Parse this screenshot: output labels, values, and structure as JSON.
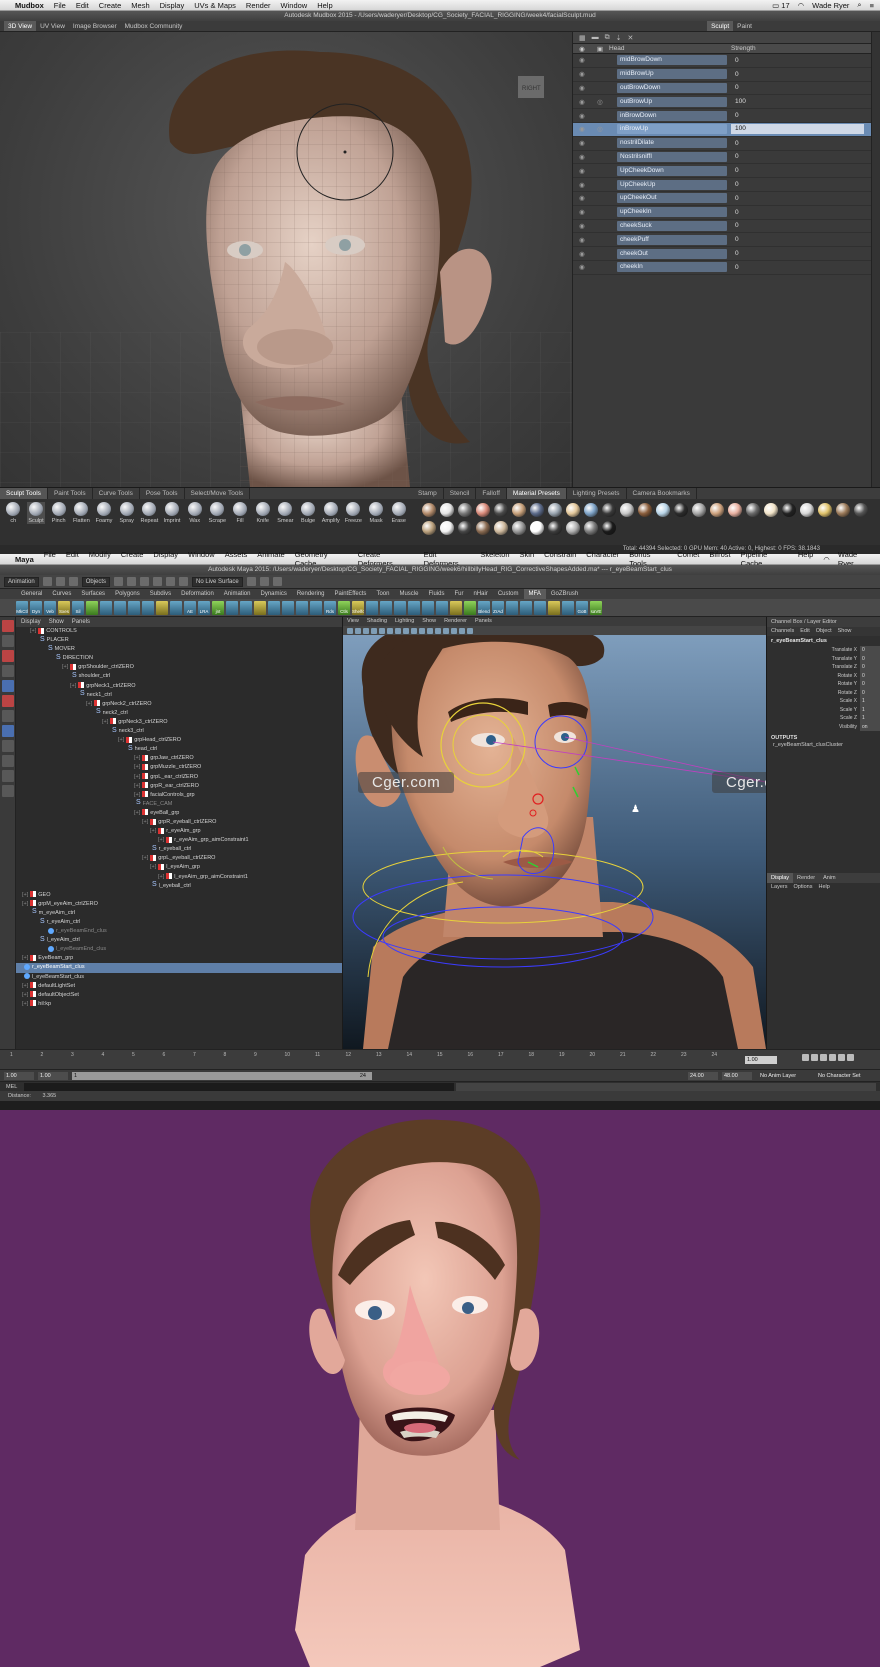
{
  "mudbox": {
    "menubar": {
      "app": "Mudbox",
      "items": [
        "File",
        "Edit",
        "Create",
        "Mesh",
        "Display",
        "UVs & Maps",
        "Render",
        "Window",
        "Help"
      ],
      "user": "Wade Ryer",
      "battery": "17"
    },
    "window_title": "Autodesk Mudbox 2015 - /Users/waderyer/Desktop/CG_Society_FACIAL_RIGGING/week4/facialSculpt.mud",
    "view_tabs": [
      "3D View",
      "UV View",
      "Image Browser",
      "Mudbox Community"
    ],
    "mode_tabs": [
      "Sculpt",
      "Paint"
    ],
    "layer_header": {
      "name": "Head",
      "strength": "Strength"
    },
    "layers": [
      {
        "name": "midBrowDown",
        "strength": "0"
      },
      {
        "name": "midBrowUp",
        "strength": "0"
      },
      {
        "name": "outBrowDown",
        "strength": "0"
      },
      {
        "name": "outBrowUp",
        "strength": "100"
      },
      {
        "name": "inBrowDown",
        "strength": "0"
      },
      {
        "name": "inBrowUp",
        "strength": "100",
        "selected": true
      },
      {
        "name": "nostrilDilate",
        "strength": "0"
      },
      {
        "name": "NostrilsniffI",
        "strength": "0"
      },
      {
        "name": "UpCheekDown",
        "strength": "0"
      },
      {
        "name": "UpCheekUp",
        "strength": "0"
      },
      {
        "name": "upCheekOut",
        "strength": "0"
      },
      {
        "name": "upCheekIn",
        "strength": "0"
      },
      {
        "name": "cheekSuck",
        "strength": "0"
      },
      {
        "name": "cheekPuff",
        "strength": "0"
      },
      {
        "name": "cheekOut",
        "strength": "0"
      },
      {
        "name": "cheekIn",
        "strength": "0"
      }
    ],
    "tray_tabs_left": [
      "Sculpt Tools",
      "Paint Tools",
      "Curve Tools",
      "Pose Tools",
      "Select/Move Tools"
    ],
    "tray_tabs_right": [
      "Stamp",
      "Stencil",
      "Falloff",
      "Material Presets",
      "Lighting Presets",
      "Camera Bookmarks"
    ],
    "brushes": [
      "ch",
      "Sculpt",
      "Pinch",
      "Flatten",
      "Foamy",
      "Spray",
      "Repeat",
      "Imprint",
      "Wax",
      "Scrape",
      "Fill",
      "Knife",
      "Smear",
      "Bulge",
      "Amplify",
      "Freeze",
      "Mask",
      "Erase"
    ],
    "material_colors": [
      "#b48c6c",
      "#e6e6e6",
      "#7a7a7a",
      "#d98a7a",
      "#4a4a4a",
      "#c7a07a",
      "#5c6b8a",
      "#9aa5b0",
      "#e4c89b",
      "#7ea3c7",
      "#3a3a3a",
      "#c9c9c9",
      "#8b5e3c",
      "#b9d5e8",
      "#2b2b2b",
      "#a7a7a7",
      "#cfa37f",
      "#e8b0a0",
      "#6b6b6b",
      "#f1e3c8",
      "#222222",
      "#d8d8d8",
      "#e0c26b",
      "#9c7b5a",
      "#555555",
      "#bca27e",
      "#f3f3f3",
      "#474747",
      "#896a51",
      "#cdb89c",
      "#999999",
      "#ffffff",
      "#3d3d3d",
      "#b0b0b0",
      "#7c7c7c",
      "#1a1a1a"
    ],
    "status": "Total: 44394   Selected: 0   GPU Mem: 40   Active: 0, Highest: 0   FPS: 38.1843"
  },
  "maya": {
    "menubar": {
      "app": "Maya",
      "items": [
        "File",
        "Edit",
        "Modify",
        "Create",
        "Display",
        "Window",
        "Assets",
        "Animate",
        "Geometry Cache",
        "Create Deformers",
        "Edit Deformers",
        "Skeleton",
        "Skin",
        "Constrain",
        "Character",
        "Bonus Tools",
        "Comet",
        "Bifrost",
        "Pipeline Cache",
        "Help"
      ],
      "user": "Wade Ryer"
    },
    "window_title": "Autodesk Maya 2015: /Users/waderyer/Desktop/CG_Society_FACIAL_RIGGING/week6/hillbillyHead_RIG_CorrectiveShapesAdded.ma*  ---  r_eyeBeamStart_clus",
    "mode": "Animation",
    "selection_mode": "Objects",
    "live_surface": "No Live Surface",
    "shelf_tabs": [
      "General",
      "Curves",
      "Surfaces",
      "Polygons",
      "Subdivs",
      "Deformation",
      "Animation",
      "Dynamics",
      "Rendering",
      "PaintEffects",
      "Toon",
      "Muscle",
      "Fluids",
      "Fur",
      "nHair",
      "Custom",
      "MFA",
      "GoZBrush"
    ],
    "active_shelf": "MFA",
    "shelf_labels": [
      "MkCtl",
      "Dyn",
      "Veb",
      "Sxes",
      "Sil",
      "",
      "",
      "",
      "",
      "",
      "",
      "",
      "AE",
      "LRA",
      "jnt",
      "",
      "",
      "",
      "",
      "",
      "",
      "",
      "Rds",
      "Ctls",
      "Shelfc",
      "",
      "",
      "",
      "",
      "",
      "",
      "",
      "",
      "Blend",
      "ZrAd",
      "",
      "",
      "",
      "",
      "",
      "GoB",
      "saVE"
    ],
    "outliner_menu": [
      "Display",
      "Show",
      "Panels"
    ],
    "outliner": [
      {
        "d": 1,
        "t": "tr",
        "n": "CONTROLS"
      },
      {
        "d": 2,
        "t": "cv",
        "n": "PLACER"
      },
      {
        "d": 3,
        "t": "cv",
        "n": "MOVER"
      },
      {
        "d": 4,
        "t": "cv",
        "n": "DIRECTION"
      },
      {
        "d": 5,
        "t": "tr",
        "n": "grpShoulder_ctrlZERO"
      },
      {
        "d": 6,
        "t": "cv",
        "n": "shoulder_ctrl"
      },
      {
        "d": 6,
        "t": "tr",
        "n": "grpNeck1_ctrlZERO"
      },
      {
        "d": 7,
        "t": "cv",
        "n": "neck1_ctrl"
      },
      {
        "d": 8,
        "t": "tr",
        "n": "grpNeck2_ctrlZERO"
      },
      {
        "d": 9,
        "t": "cv",
        "n": "neck2_ctrl"
      },
      {
        "d": 10,
        "t": "tr",
        "n": "grpNeck3_ctrlZERO"
      },
      {
        "d": 11,
        "t": "cv",
        "n": "neck3_ctrl"
      },
      {
        "d": 12,
        "t": "tr",
        "n": "grpHead_ctrlZERO"
      },
      {
        "d": 13,
        "t": "cv",
        "n": "head_ctrl"
      },
      {
        "d": 14,
        "t": "tr",
        "n": "grpJaw_ctrlZERO"
      },
      {
        "d": 14,
        "t": "tr",
        "n": "grpMuzzle_ctrlZERO"
      },
      {
        "d": 14,
        "t": "tr",
        "n": "grpL_ear_ctrlZERO"
      },
      {
        "d": 14,
        "t": "tr",
        "n": "grpR_ear_ctrlZERO"
      },
      {
        "d": 14,
        "t": "tr",
        "n": "facialControls_grp"
      },
      {
        "d": 14,
        "t": "cv",
        "n": "FACE_CAM",
        "dim": true
      },
      {
        "d": 14,
        "t": "tr",
        "n": "eyeBall_grp"
      },
      {
        "d": 15,
        "t": "tr",
        "n": "grpR_eyeball_ctrlZERO"
      },
      {
        "d": 16,
        "t": "tr",
        "n": "r_eyeAim_grp"
      },
      {
        "d": 17,
        "t": "tr",
        "n": "r_eyeAim_grp_aimConstraint1"
      },
      {
        "d": 16,
        "t": "cv",
        "n": "r_eyeball_ctrl"
      },
      {
        "d": 15,
        "t": "tr",
        "n": "grpL_eyeball_ctrlZERO"
      },
      {
        "d": 16,
        "t": "tr",
        "n": "l_eyeAim_grp"
      },
      {
        "d": 17,
        "t": "tr",
        "n": "l_eyeAim_grp_aimConstraint1"
      },
      {
        "d": 16,
        "t": "cv",
        "n": "l_eyeball_ctrl"
      },
      {
        "d": 0,
        "t": "tr",
        "n": "GEO"
      },
      {
        "d": 0,
        "t": "tr",
        "n": "grpM_eyeAim_ctrlZERO"
      },
      {
        "d": 1,
        "t": "cv",
        "n": "m_eyeAim_ctrl"
      },
      {
        "d": 2,
        "t": "cv",
        "n": "r_eyeAim_ctrl"
      },
      {
        "d": 3,
        "t": "cl",
        "n": "r_eyeBeamEnd_clus",
        "dim": true
      },
      {
        "d": 2,
        "t": "cv",
        "n": "l_eyeAim_ctrl"
      },
      {
        "d": 3,
        "t": "cl",
        "n": "l_eyeBeamEnd_clus",
        "dim": true
      },
      {
        "d": 0,
        "t": "tr",
        "n": "EyeBeam_grp"
      },
      {
        "d": 0,
        "t": "cl",
        "n": "r_eyeBeamStart_clus",
        "sel": true
      },
      {
        "d": 0,
        "t": "cl",
        "n": "l_eyeBeamStart_clus"
      },
      {
        "d": 0,
        "t": "tr",
        "n": "defaultLightSet"
      },
      {
        "d": 0,
        "t": "tr",
        "n": "defaultObjectSet"
      },
      {
        "d": 0,
        "t": "tr",
        "n": "hil:kp"
      }
    ],
    "viewport_menu": [
      "View",
      "Shading",
      "Lighting",
      "Show",
      "Renderer",
      "Panels"
    ],
    "channel_box": {
      "title": "Channel Box / Layer Editor",
      "menu": [
        "Channels",
        "Edit",
        "Object",
        "Show"
      ],
      "node": "r_eyeBeamStart_clus",
      "attrs": [
        {
          "k": "Translate X",
          "v": "0"
        },
        {
          "k": "Translate Y",
          "v": "0"
        },
        {
          "k": "Translate Z",
          "v": "0"
        },
        {
          "k": "Rotate X",
          "v": "0"
        },
        {
          "k": "Rotate Y",
          "v": "0"
        },
        {
          "k": "Rotate Z",
          "v": "0"
        },
        {
          "k": "Scale X",
          "v": "1"
        },
        {
          "k": "Scale Y",
          "v": "1"
        },
        {
          "k": "Scale Z",
          "v": "1"
        },
        {
          "k": "Visibility",
          "v": "on"
        }
      ],
      "outputs_label": "OUTPUTS",
      "output_node": "r_eyeBeamStart_clusCluster",
      "layer_tabs": [
        "Display",
        "Render",
        "Anim"
      ],
      "layer_menu": [
        "Layers",
        "Options",
        "Help"
      ]
    },
    "timeline": {
      "ticks": [
        "1",
        "2",
        "3",
        "4",
        "5",
        "6",
        "7",
        "8",
        "9",
        "10",
        "11",
        "12",
        "13",
        "14",
        "15",
        "16",
        "17",
        "18",
        "19",
        "20",
        "21",
        "22",
        "23",
        "24"
      ],
      "current": "1.00"
    },
    "range": {
      "start": "1.00",
      "inner_start": "1.00",
      "mark": "1",
      "inner_end": "24",
      "end1": "24.00",
      "end2": "48.00",
      "anim_layer": "No Anim Layer",
      "char_set": "No Character Set"
    },
    "cmd_label": "MEL",
    "help": {
      "label": "Distance:",
      "value": "3.365"
    }
  },
  "watermark": "Cger.com"
}
